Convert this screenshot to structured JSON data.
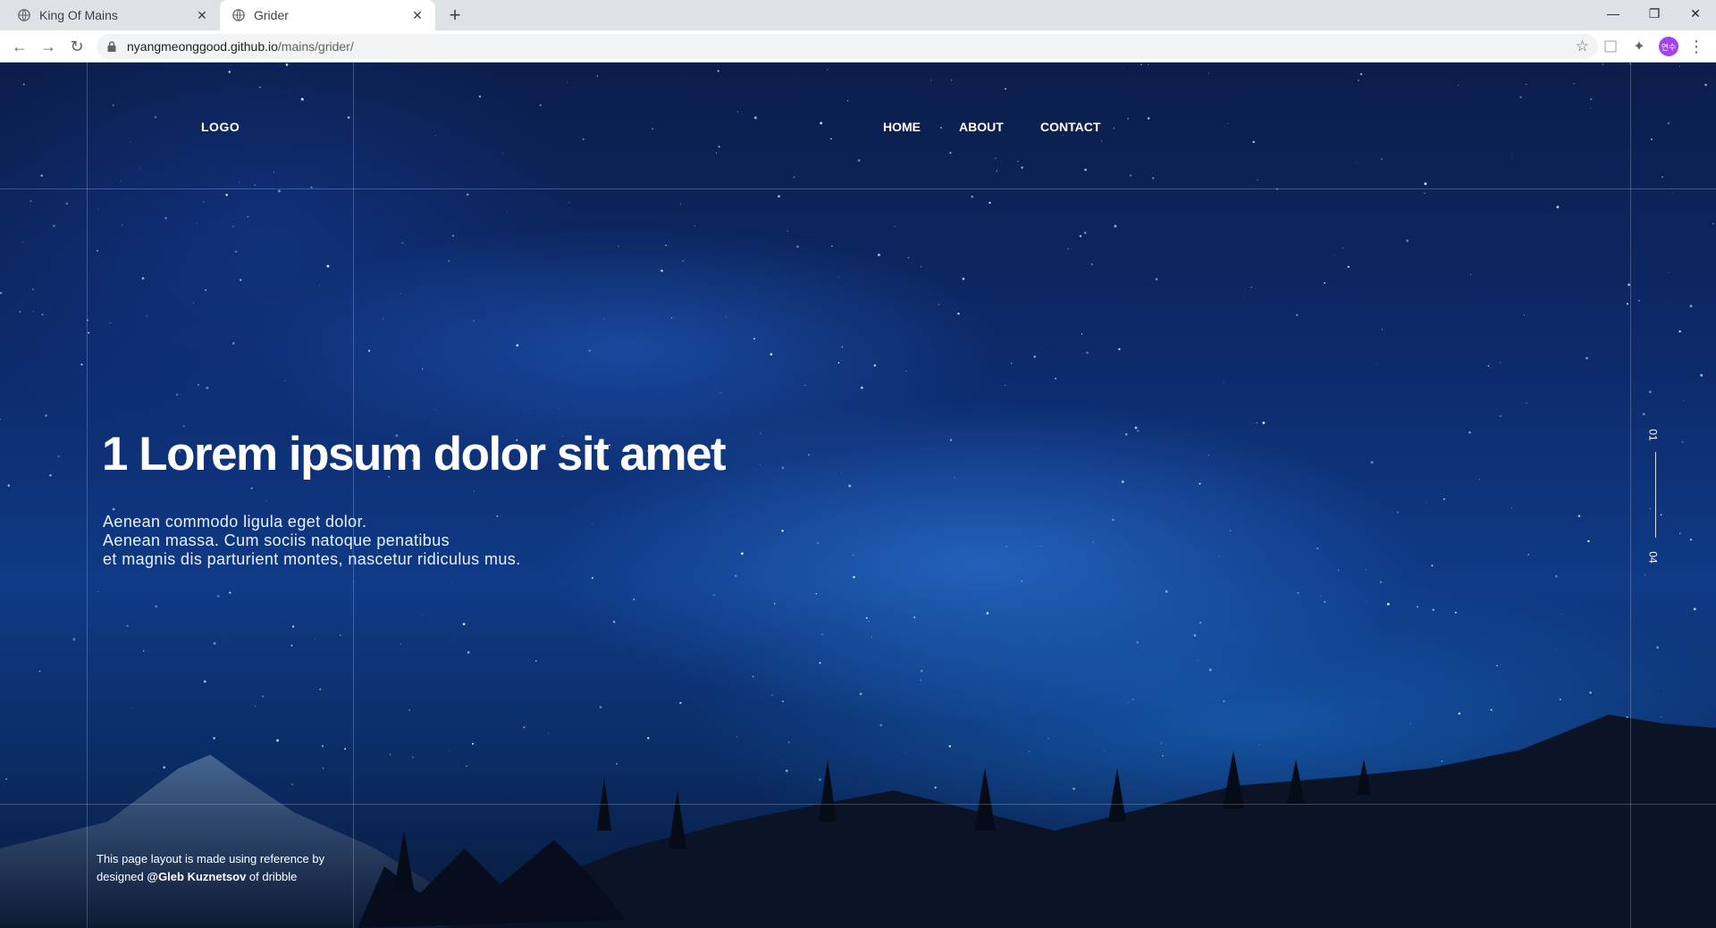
{
  "browser": {
    "tabs": [
      {
        "title": "King Of Mains",
        "active": false
      },
      {
        "title": "Grider",
        "active": true
      }
    ],
    "new_tab_label": "+",
    "url_host": "nyangmeonggood.github.io",
    "url_path": "/mains/grider/",
    "avatar_text": "연수"
  },
  "page": {
    "logo": "LOGO",
    "nav": [
      "HOME",
      "ABOUT",
      "CONTACT"
    ],
    "hero": {
      "title": "1 Lorem ipsum dolor sit amet",
      "body": [
        "Aenean commodo ligula eget dolor.",
        "Aenean massa. Cum sociis natoque penatibus",
        "et magnis dis parturient montes, nascetur ridiculus mus."
      ]
    },
    "pager": {
      "current": "01",
      "total": "04"
    },
    "footer": {
      "line1": "This page layout is made using reference by",
      "prefix": "designed ",
      "author": "@Gleb Kuznetsov",
      "suffix": " of dribble"
    }
  },
  "colors": {
    "chrome_bg": "#dee1e6",
    "sky_deep": "#0b1d4a",
    "sky_glow": "#3282e6",
    "text": "#ffffff"
  }
}
